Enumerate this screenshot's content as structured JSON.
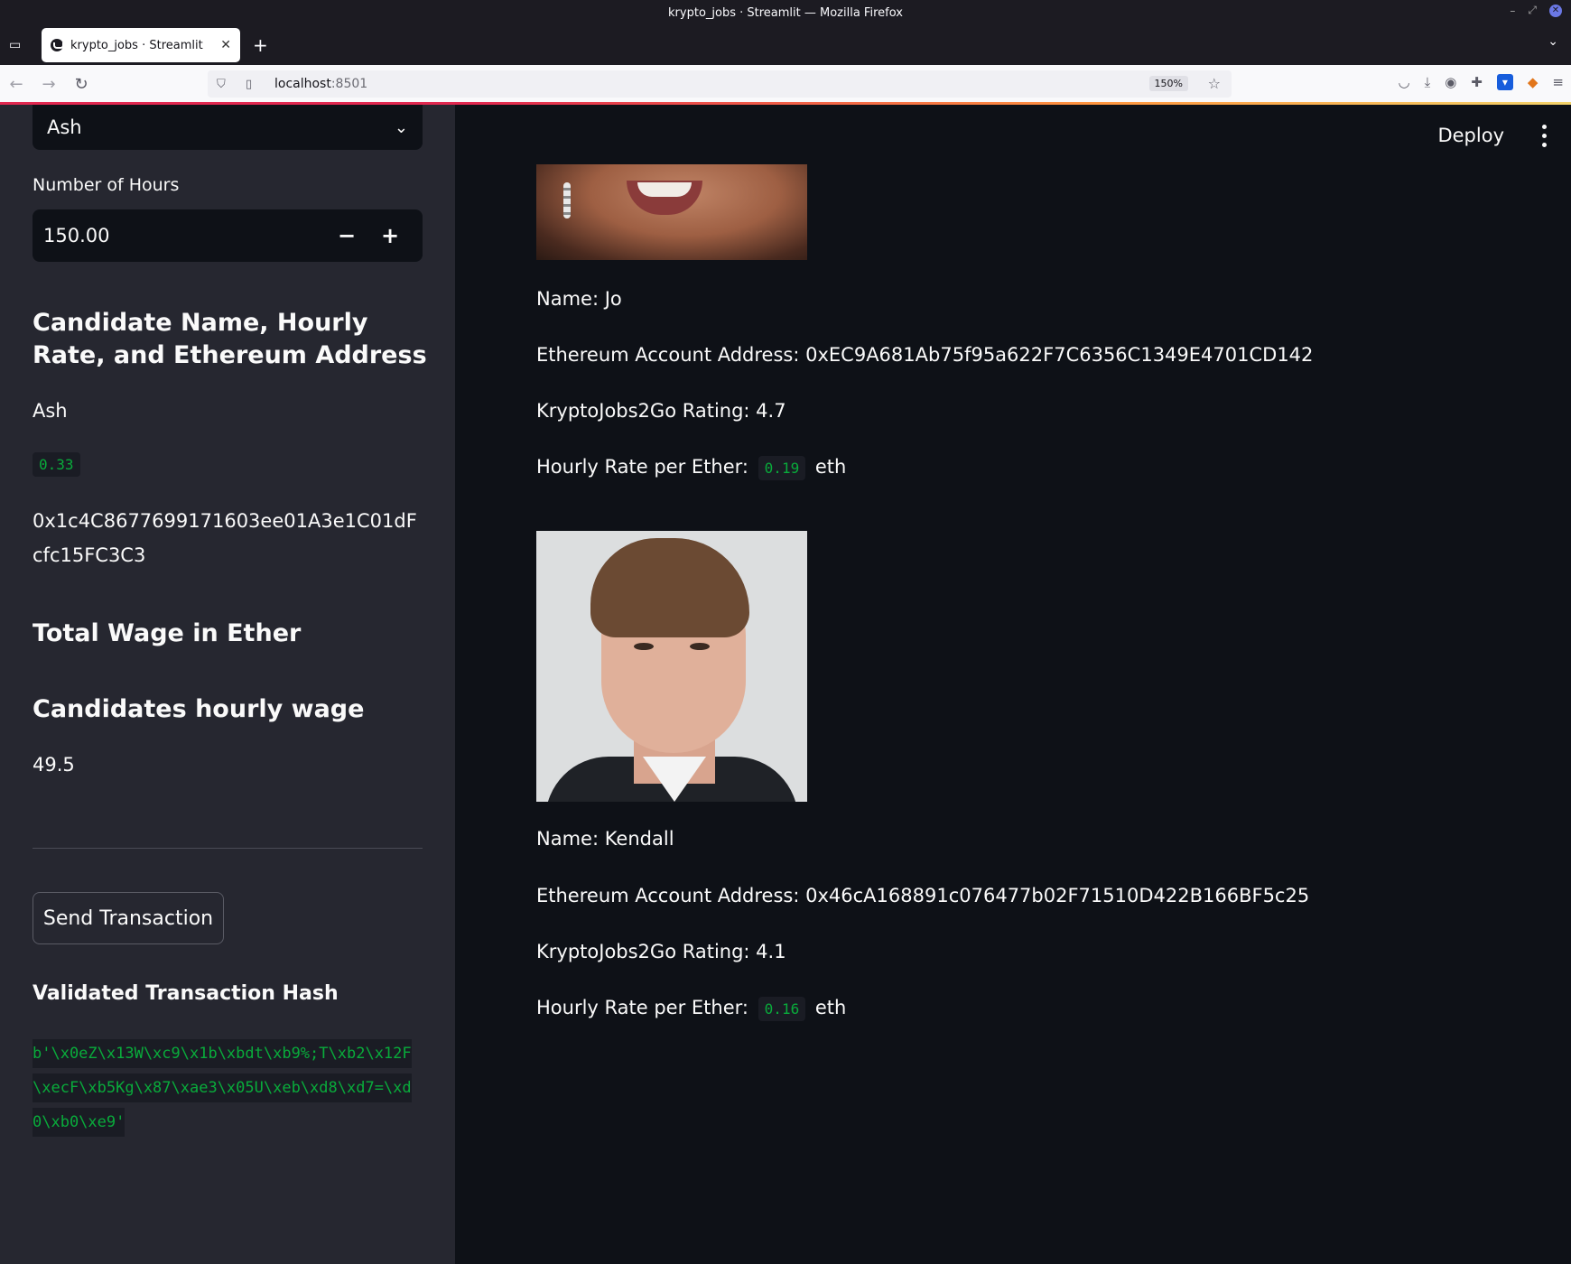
{
  "browser": {
    "window_title": "krypto_jobs · Streamlit — Mozilla Firefox",
    "tab_title": "krypto_jobs · Streamlit",
    "url_host": "localhost",
    "url_port": ":8501",
    "zoom": "150%"
  },
  "sidebar": {
    "select_value": "Ash",
    "hours_label": "Number of Hours",
    "hours_value": "150.00",
    "heading_candidate": "Candidate Name, Hourly Rate, and Ethereum Address",
    "candidate_name": "Ash",
    "candidate_rate": "0.33",
    "candidate_address": "0x1c4C8677699171603ee01A3e1C01dFcfc15FC3C3",
    "heading_total": "Total Wage in Ether",
    "heading_hourly": "Candidates hourly wage",
    "wage_value": "49.5",
    "send_button": "Send Transaction",
    "hash_heading": "Validated Transaction Hash",
    "hash_value": "b'\\x0eZ\\x13W\\xc9\\x1b\\xbdt\\xb9%;T\\xb2\\x12F\\xecF\\xb5Kg\\x87\\xae3\\x05U\\xeb\\xd8\\xd7=\\xd0\\xb0\\xe9'"
  },
  "header": {
    "deploy": "Deploy"
  },
  "candidates": [
    {
      "name_line": "Name: Jo",
      "address_line": "Ethereum Account Address: 0xEC9A681Ab75f95a622F7C6356C1349E4701CD142",
      "rating_line": "KryptoJobs2Go Rating: 4.7",
      "rate_prefix": "Hourly Rate per Ether:",
      "rate_value": "0.19",
      "rate_unit": "eth"
    },
    {
      "name_line": "Name: Kendall",
      "address_line": "Ethereum Account Address: 0x46cA168891c076477b02F71510D422B166BF5c25",
      "rating_line": "KryptoJobs2Go Rating: 4.1",
      "rate_prefix": "Hourly Rate per Ether:",
      "rate_value": "0.16",
      "rate_unit": "eth"
    }
  ]
}
